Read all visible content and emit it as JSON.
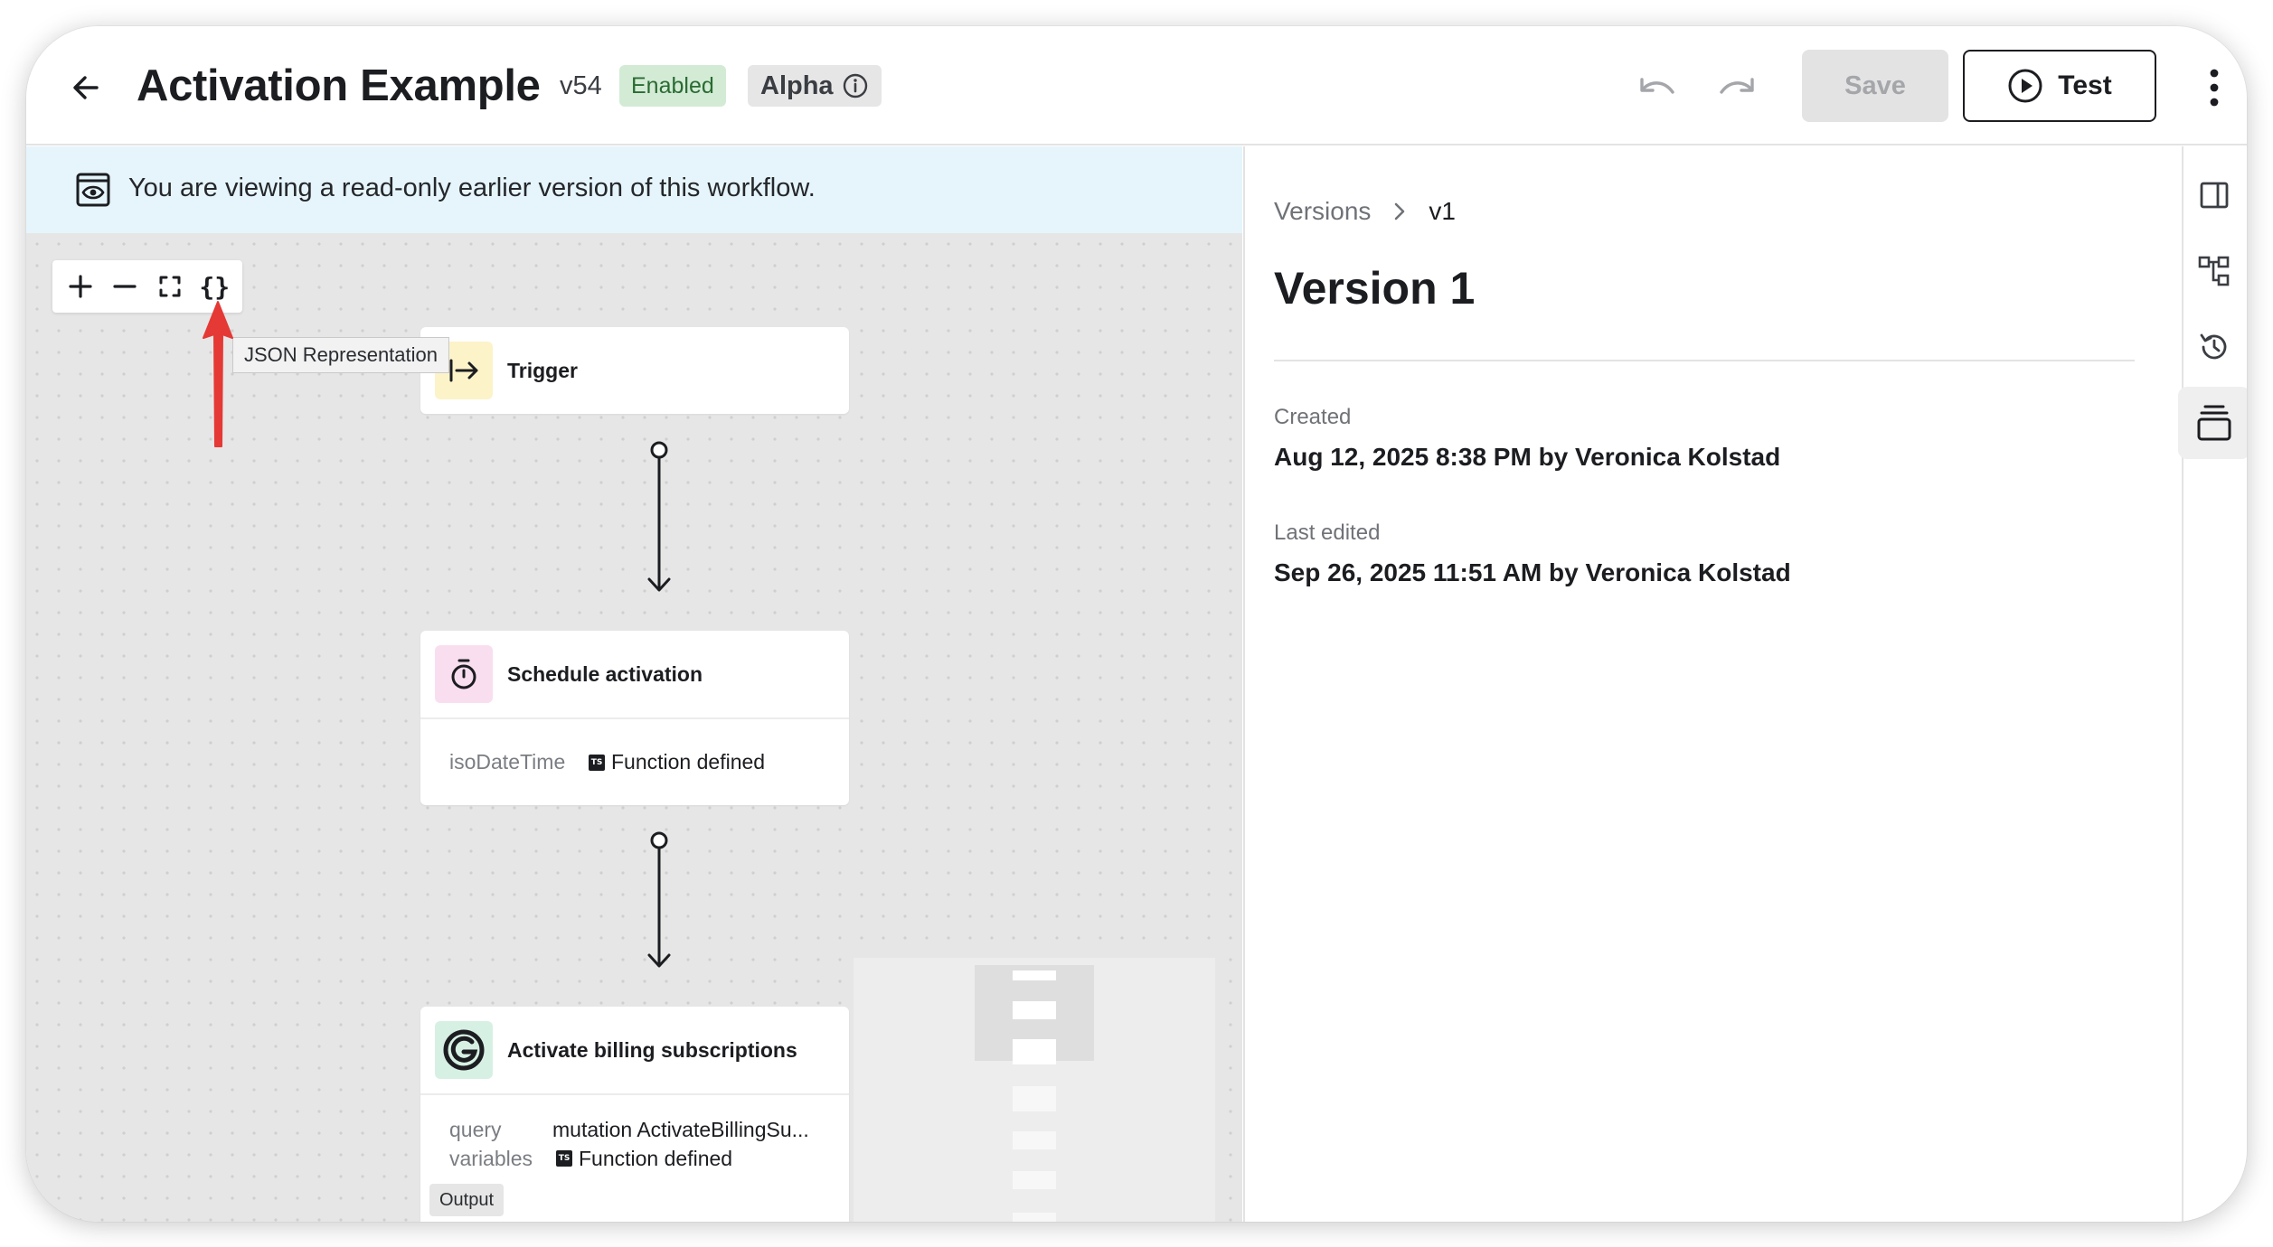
{
  "header": {
    "title": "Activation Example",
    "version": "v54",
    "status_badge": "Enabled",
    "stage_badge": "Alpha",
    "save_label": "Save",
    "test_label": "Test"
  },
  "banner": {
    "text": "You are viewing a read-only earlier version of this workflow."
  },
  "canvas": {
    "zoom_controls": {
      "zoom_in": "+",
      "zoom_out": "–",
      "fit": "[ ]",
      "json": "{}"
    },
    "tooltip": "JSON Representation",
    "nodes": [
      {
        "title": "Trigger",
        "icon": "arrow-right-to-line-icon"
      },
      {
        "title": "Schedule activation",
        "icon": "stopwatch-icon",
        "props": [
          {
            "key": "isoDateTime",
            "value": "Function defined",
            "badge": "TS"
          }
        ]
      },
      {
        "title": "Activate billing subscriptions",
        "icon": "billing-logo-icon",
        "props": [
          {
            "key": "query",
            "value": "mutation ActivateBillingSu..."
          },
          {
            "key": "variables",
            "value": "Function defined",
            "badge": "TS"
          }
        ],
        "output_label": "Output"
      }
    ]
  },
  "detail_panel": {
    "breadcrumb": {
      "parent": "Versions",
      "current": "v1"
    },
    "title": "Version 1",
    "created_label": "Created",
    "created_value": "Aug 12, 2025 8:38 PM by Veronica Kolstad",
    "edited_label": "Last edited",
    "edited_value": "Sep 26, 2025 11:51 AM by Veronica Kolstad"
  },
  "right_rail": {
    "items": [
      {
        "icon": "panel-right-icon"
      },
      {
        "icon": "workflow-tree-icon"
      },
      {
        "icon": "history-icon"
      },
      {
        "icon": "versions-stack-icon",
        "active": true
      }
    ]
  },
  "colors": {
    "banner_bg": "#e6f5fb",
    "enabled_badge_bg": "#d3ebd5",
    "enabled_badge_text": "#2a6b32",
    "canvas_bg": "#e6e6e6",
    "annotation_arrow": "#e53935",
    "trigger_icon_bg": "#fdf3c9",
    "schedule_icon_bg": "#f9def0",
    "billing_icon_bg": "#d7f0e4"
  }
}
